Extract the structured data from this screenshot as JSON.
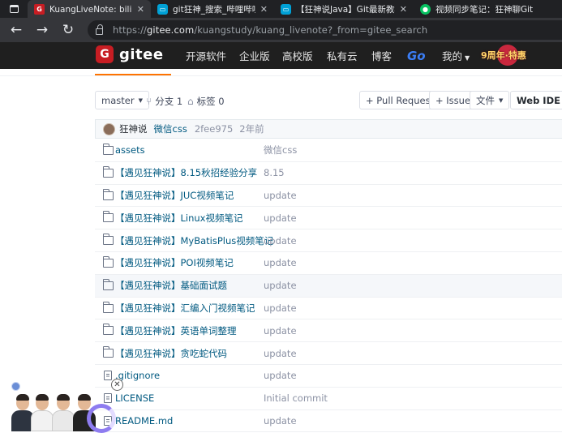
{
  "browser": {
    "tabs": [
      {
        "title": "KuangLiveNote: bilibili 狂神说Java",
        "favicon": "gitee-favicon",
        "favicon_color": "#c71d23",
        "active": true
      },
      {
        "title": "git狂神_搜索_哔哩哔哩-bilibili",
        "favicon": "bilibili-favicon",
        "favicon_color": "#00a1d6",
        "active": false
      },
      {
        "title": "【狂神说Java】Git最新教程通俗",
        "favicon": "bilibili-favicon",
        "favicon_color": "#00a1d6",
        "active": false
      },
      {
        "title": "视频同步笔记：狂神聊Git",
        "favicon": "wechat-favicon",
        "favicon_color": "#07c160",
        "active": false
      }
    ],
    "url_scheme": "https://",
    "url_host": "gitee.com",
    "url_path": "/kuangstudy/kuang_livenote?_from=gitee_search"
  },
  "gitee": {
    "logo_text": "gitee",
    "nav": [
      "开源软件",
      "企业版",
      "高校版",
      "私有云",
      "博客",
      "Go",
      "我的"
    ],
    "promo_text": "9周年·特惠",
    "brand_color": "#c71d23"
  },
  "toolbar": {
    "branch": "master",
    "branches": "分支 1",
    "tags": "标签 0",
    "pull_request": "+ Pull Request",
    "issue": "+ Issue",
    "files": "文件",
    "web_ide": "Web IDE"
  },
  "commit": {
    "author": "狂神说",
    "message": "微信css",
    "hash": "2fee975",
    "ago": "2年前"
  },
  "files": [
    {
      "name": "assets",
      "type": "folder",
      "commit": "微信css"
    },
    {
      "name": "【遇见狂神说】8.15秋招经验分享",
      "type": "folder",
      "commit": "8.15"
    },
    {
      "name": "【遇见狂神说】JUC视频笔记",
      "type": "folder",
      "commit": "update"
    },
    {
      "name": "【遇见狂神说】Linux视频笔记",
      "type": "folder",
      "commit": "update"
    },
    {
      "name": "【遇见狂神说】MyBatisPlus视频笔记",
      "type": "folder",
      "commit": "update"
    },
    {
      "name": "【遇见狂神说】POI视频笔记",
      "type": "folder",
      "commit": "update"
    },
    {
      "name": "【遇见狂神说】基础面试题",
      "type": "folder",
      "commit": "update",
      "highlight": true
    },
    {
      "name": "【遇见狂神说】汇编入门视频笔记",
      "type": "folder",
      "commit": "update"
    },
    {
      "name": "【遇见狂神说】英语单词整理",
      "type": "folder",
      "commit": "update"
    },
    {
      "name": "【遇见狂神说】贪吃蛇代码",
      "type": "folder",
      "commit": "update"
    },
    {
      "name": ".gitignore",
      "type": "file",
      "commit": "update"
    },
    {
      "name": "LICENSE",
      "type": "file",
      "commit": "Initial commit"
    },
    {
      "name": "README.md",
      "type": "file",
      "commit": "update"
    }
  ]
}
